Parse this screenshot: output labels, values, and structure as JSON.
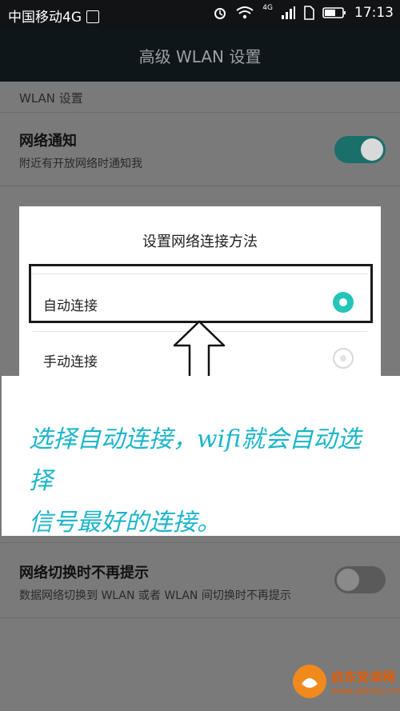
{
  "status_bar": {
    "carrier": "中国移动4G",
    "time": "17:13",
    "net_badge": "4G"
  },
  "header": {
    "title": "高级 WLAN 设置"
  },
  "settings": {
    "section_title": "WLAN 设置",
    "network_notify": {
      "title": "网络通知",
      "subtitle": "附近有开放网络时通知我",
      "enabled": true
    },
    "no_prompt_switch": {
      "title": "网络切换时不再提示",
      "subtitle": "数据网络切换到 WLAN 或者 WLAN 间切换时不再提示",
      "enabled": false
    }
  },
  "dialog": {
    "title": "设置网络连接方法",
    "options": [
      {
        "label": "自动连接",
        "selected": true
      },
      {
        "label": "手动连接",
        "selected": false
      }
    ]
  },
  "annotation": {
    "line1": "选择自动连接，wifi就会自动选择",
    "line2": "信号最好的连接。"
  },
  "watermark": {
    "name": "启东安卓网",
    "url": "www.qdlxtq.com"
  },
  "colors": {
    "accent": "#1a8a84",
    "annotation": "#1cb5c9"
  }
}
